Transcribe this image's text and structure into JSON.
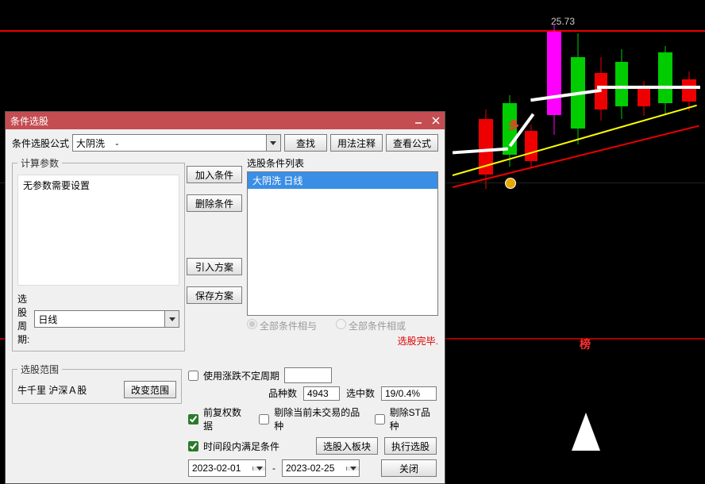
{
  "chart": {
    "price_label": "25.73",
    "rank_mark": "榜",
    "multi_mark": "多"
  },
  "dialog": {
    "title": "条件选股",
    "formula_label": "条件选股公式",
    "formula_value": "大阴洗    -",
    "btn_find": "查找",
    "btn_usage": "用法注释",
    "btn_view_formula": "查看公式",
    "calc_params_legend": "计算参数",
    "no_params_text": "无参数需要设置",
    "period_label": "选股周期:",
    "period_value": "日线",
    "btn_add_cond": "加入条件",
    "btn_del_cond": "删除条件",
    "btn_import_plan": "引入方案",
    "btn_save_plan": "保存方案",
    "cond_list_label": "选股条件列表",
    "cond_items": [
      "大阴洗  日线"
    ],
    "radio_and": "全部条件相与",
    "radio_or": "全部条件相或",
    "done_text": "选股完毕.",
    "range_legend": "选股范围",
    "range_value": "牛千里 沪深Ａ股",
    "btn_change_range": "改变范围",
    "chk_use_variable_period": "使用涨跌不定周期",
    "stat_count_label": "品种数",
    "stat_count_value": "4943",
    "stat_hit_label": "选中数",
    "stat_hit_value": "19/0.4%",
    "chk_preadj": "前复权数据",
    "chk_excl_nontrade": "剔除当前未交易的品种",
    "chk_excl_st": "剔除ST品种",
    "chk_time_match": "时间段内满足条件",
    "btn_to_block": "选股入板块",
    "btn_run": "执行选股",
    "date_from": "2023-02-01",
    "date_to": "2023-02-25",
    "btn_close": "关闭"
  }
}
